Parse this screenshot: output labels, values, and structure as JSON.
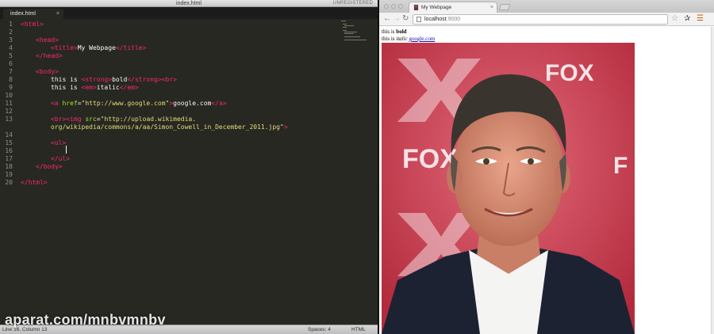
{
  "editor": {
    "window_title": "index.html",
    "unregistered": "UNREGISTERED",
    "tab": {
      "label": "index.html",
      "close": "×"
    },
    "line_numbers": [
      "1",
      "2",
      "3",
      "4",
      "5",
      "6",
      "7",
      "8",
      "9",
      "10",
      "11",
      "12",
      "13",
      "14",
      "15",
      "16",
      "17",
      "18",
      "19",
      "20"
    ],
    "code": {
      "l1": "<html>",
      "l3": "<head>",
      "l4a": "<title>",
      "l4b": "My Webpage",
      "l4c": "</title>",
      "l5": "</head>",
      "l7": "<body>",
      "l8a": "this is ",
      "l8b": "<strong>",
      "l8c": "bold",
      "l8d": "</strong>",
      "l8e": "<br>",
      "l9a": "this is ",
      "l9b": "<em>",
      "l9c": "italic",
      "l9d": "</em>",
      "l11a": "<a ",
      "l11b": "href",
      "l11c": "=",
      "l11d": "\"http://www.google.com\"",
      "l11e": ">",
      "l11f": "google.com",
      "l11g": "</a>",
      "l13a": "<br>",
      "l13b": "<img ",
      "l13c": "src",
      "l13d": "=",
      "l13e": "\"http://upload.wikimedia.",
      "l13f": "org/wikipedia/commons/a/aa/Simon_Cowell_in_December_2011.jpg\"",
      "l13g": ">",
      "l15": "<ul>",
      "l17": "</ul>",
      "l18": "</body>",
      "l20": "</html>"
    },
    "status": {
      "position": "Line 16, Column 13",
      "spaces": "Spaces: 4",
      "syntax": "HTML"
    }
  },
  "watermark": "aparat.com/mnbvmnbv",
  "browser": {
    "tab": {
      "label": "My Webpage",
      "close": "×"
    },
    "url_host": "localhost",
    "url_port": ":9000",
    "page": {
      "line1_prefix": "this is ",
      "line1_bold": "bold",
      "line2_prefix": "this is ",
      "line2_italic": "italic",
      "link_text": "google.com"
    }
  },
  "colors": {
    "editor_bg": "#272822",
    "tag": "#f92672",
    "attr": "#a6e22e",
    "string": "#e6db74",
    "link": "#1a0dab"
  }
}
